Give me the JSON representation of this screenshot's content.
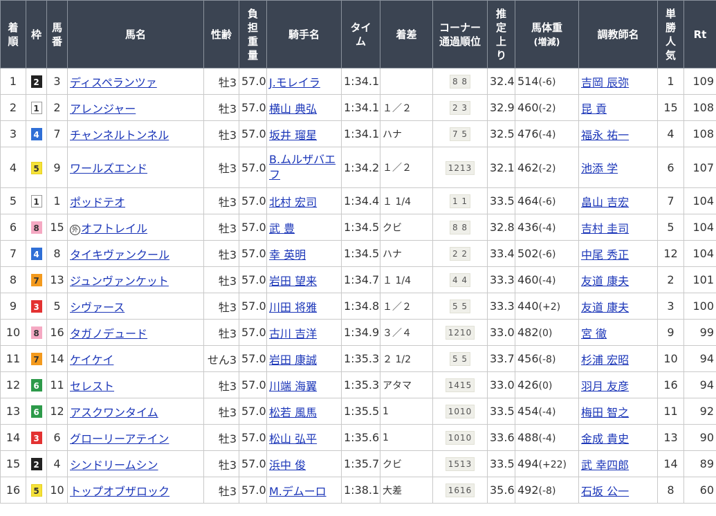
{
  "headers": {
    "rank": [
      "着",
      "順"
    ],
    "waku": "枠",
    "umaban": [
      "馬",
      "番"
    ],
    "name": "馬名",
    "sexage": "性齢",
    "weight": [
      "負",
      "担",
      "重",
      "量"
    ],
    "jockey": "騎手名",
    "time": [
      "タイ",
      "ム"
    ],
    "margin": "着差",
    "corner": [
      "コーナー",
      "通過順位"
    ],
    "last3f": [
      "推",
      "定",
      "上",
      "り"
    ],
    "body": [
      "馬体重",
      "(増減)"
    ],
    "trainer": "調教師名",
    "popularity": [
      "単",
      "勝",
      "人",
      "気"
    ],
    "rt": "Rt"
  },
  "waku_colors": {
    "1": {
      "bg": "#ffffff",
      "fg": "#333333",
      "border": "#999999"
    },
    "2": {
      "bg": "#222222",
      "fg": "#ffffff",
      "border": "#222222"
    },
    "3": {
      "bg": "#e33232",
      "fg": "#ffffff",
      "border": "#e33232"
    },
    "4": {
      "bg": "#2f6fd6",
      "fg": "#ffffff",
      "border": "#2f6fd6"
    },
    "5": {
      "bg": "#f5e23a",
      "fg": "#333333",
      "border": "#e6cf1e"
    },
    "6": {
      "bg": "#2d9a4a",
      "fg": "#ffffff",
      "border": "#2d9a4a"
    },
    "7": {
      "bg": "#f39a1e",
      "fg": "#333333",
      "border": "#f39a1e"
    },
    "8": {
      "bg": "#f5a9c3",
      "fg": "#333333",
      "border": "#f5a9c3"
    }
  },
  "rows": [
    {
      "rank": "1",
      "waku": "2",
      "umaban": "3",
      "mark": "",
      "name": "ディスペランツァ",
      "sexage": "牡3",
      "weight": "57.0",
      "jockey": "J.モレイラ",
      "jockey_link": true,
      "time": "1:34.1",
      "margin": "",
      "corner": "8 8",
      "last3f": "32.4",
      "body": "514",
      "diff": "(-6)",
      "trainer": "吉岡 辰弥",
      "popularity": "1",
      "rt": "109"
    },
    {
      "rank": "2",
      "waku": "1",
      "umaban": "2",
      "mark": "",
      "name": "アレンジャー",
      "sexage": "牡3",
      "weight": "57.0",
      "jockey": "横山 典弘",
      "jockey_link": true,
      "time": "1:34.1",
      "margin": "１／２",
      "corner": "2 3",
      "last3f": "32.9",
      "body": "460",
      "diff": "(-2)",
      "trainer": "昆 貢",
      "popularity": "15",
      "rt": "108"
    },
    {
      "rank": "3",
      "waku": "4",
      "umaban": "7",
      "mark": "",
      "name": "チャンネルトンネル",
      "sexage": "牡3",
      "weight": "57.0",
      "jockey": "坂井 瑠星",
      "jockey_link": true,
      "time": "1:34.1",
      "margin": "ハナ",
      "corner": "7 5",
      "last3f": "32.5",
      "body": "476",
      "diff": "(-4)",
      "trainer": "福永 祐一",
      "popularity": "4",
      "rt": "108"
    },
    {
      "rank": "4",
      "waku": "5",
      "umaban": "9",
      "mark": "",
      "name": "ワールズエンド",
      "sexage": "牡3",
      "weight": "57.0",
      "jockey": "B.ムルザバエフ",
      "jockey_link": false,
      "time": "1:34.2",
      "margin": "１／２",
      "corner": "1213",
      "last3f": "32.1",
      "body": "462",
      "diff": "(-2)",
      "trainer": "池添 学",
      "popularity": "6",
      "rt": "107"
    },
    {
      "rank": "5",
      "waku": "1",
      "umaban": "1",
      "mark": "",
      "name": "ポッドテオ",
      "sexage": "牡3",
      "weight": "57.0",
      "jockey": "北村 宏司",
      "jockey_link": true,
      "time": "1:34.4",
      "margin": "１ 1/4",
      "corner": "1 1",
      "last3f": "33.5",
      "body": "464",
      "diff": "(-6)",
      "trainer": "畠山 吉宏",
      "popularity": "7",
      "rt": "104"
    },
    {
      "rank": "6",
      "waku": "8",
      "umaban": "15",
      "mark": "外",
      "name": "オフトレイル",
      "sexage": "牡3",
      "weight": "57.0",
      "jockey": "武 豊",
      "jockey_link": true,
      "time": "1:34.5",
      "margin": "クビ",
      "corner": "8 8",
      "last3f": "32.8",
      "body": "436",
      "diff": "(-4)",
      "trainer": "吉村 圭司",
      "popularity": "5",
      "rt": "104"
    },
    {
      "rank": "7",
      "waku": "4",
      "umaban": "8",
      "mark": "",
      "name": "タイキヴァンクール",
      "sexage": "牡3",
      "weight": "57.0",
      "jockey": "幸 英明",
      "jockey_link": true,
      "time": "1:34.5",
      "margin": "ハナ",
      "corner": "2 2",
      "last3f": "33.4",
      "body": "502",
      "diff": "(-6)",
      "trainer": "中尾 秀正",
      "popularity": "12",
      "rt": "104"
    },
    {
      "rank": "8",
      "waku": "7",
      "umaban": "13",
      "mark": "",
      "name": "ジュンヴァンケット",
      "sexage": "牡3",
      "weight": "57.0",
      "jockey": "岩田 望来",
      "jockey_link": true,
      "time": "1:34.7",
      "margin": "１ 1/4",
      "corner": "4 4",
      "last3f": "33.3",
      "body": "460",
      "diff": "(-4)",
      "trainer": "友道 康夫",
      "popularity": "2",
      "rt": "101"
    },
    {
      "rank": "9",
      "waku": "3",
      "umaban": "5",
      "mark": "",
      "name": "シヴァース",
      "sexage": "牡3",
      "weight": "57.0",
      "jockey": "川田 将雅",
      "jockey_link": true,
      "time": "1:34.8",
      "margin": "１／２",
      "corner": "5 5",
      "last3f": "33.3",
      "body": "440",
      "diff": "(+2)",
      "trainer": "友道 康夫",
      "popularity": "3",
      "rt": "100"
    },
    {
      "rank": "10",
      "waku": "8",
      "umaban": "16",
      "mark": "",
      "name": "タガノデュード",
      "sexage": "牡3",
      "weight": "57.0",
      "jockey": "古川 吉洋",
      "jockey_link": true,
      "time": "1:34.9",
      "margin": "３／４",
      "corner": "1210",
      "last3f": "33.0",
      "body": "482",
      "diff": "(0)",
      "trainer": "宮 徹",
      "popularity": "9",
      "rt": "99"
    },
    {
      "rank": "11",
      "waku": "7",
      "umaban": "14",
      "mark": "",
      "name": "ケイケイ",
      "sexage": "せん3",
      "weight": "57.0",
      "jockey": "岩田 康誠",
      "jockey_link": true,
      "time": "1:35.3",
      "margin": "２ 1/2",
      "corner": "5 5",
      "last3f": "33.7",
      "body": "456",
      "diff": "(-8)",
      "trainer": "杉浦 宏昭",
      "popularity": "10",
      "rt": "94"
    },
    {
      "rank": "12",
      "waku": "6",
      "umaban": "11",
      "mark": "",
      "name": "セレスト",
      "sexage": "牡3",
      "weight": "57.0",
      "jockey": "川端 海翼",
      "jockey_link": true,
      "time": "1:35.3",
      "margin": "アタマ",
      "corner": "1415",
      "last3f": "33.0",
      "body": "426",
      "diff": "(0)",
      "trainer": "羽月 友彦",
      "popularity": "16",
      "rt": "94"
    },
    {
      "rank": "13",
      "waku": "6",
      "umaban": "12",
      "mark": "",
      "name": "アスクワンタイム",
      "sexage": "牡3",
      "weight": "57.0",
      "jockey": "松若 風馬",
      "jockey_link": true,
      "time": "1:35.5",
      "margin": "1",
      "corner": "1010",
      "last3f": "33.5",
      "body": "454",
      "diff": "(-4)",
      "trainer": "梅田 智之",
      "popularity": "11",
      "rt": "92"
    },
    {
      "rank": "14",
      "waku": "3",
      "umaban": "6",
      "mark": "",
      "name": "グローリーアテイン",
      "sexage": "牡3",
      "weight": "57.0",
      "jockey": "松山 弘平",
      "jockey_link": true,
      "time": "1:35.6",
      "margin": "1",
      "corner": "1010",
      "last3f": "33.6",
      "body": "488",
      "diff": "(-4)",
      "trainer": "金成 貴史",
      "popularity": "13",
      "rt": "90"
    },
    {
      "rank": "15",
      "waku": "2",
      "umaban": "4",
      "mark": "",
      "name": "シンドリームシン",
      "sexage": "牡3",
      "weight": "57.0",
      "jockey": "浜中 俊",
      "jockey_link": true,
      "time": "1:35.7",
      "margin": "クビ",
      "corner": "1513",
      "last3f": "33.5",
      "body": "494",
      "diff": "(+22)",
      "trainer": "武 幸四郎",
      "popularity": "14",
      "rt": "89"
    },
    {
      "rank": "16",
      "waku": "5",
      "umaban": "10",
      "mark": "",
      "name": "トップオブザロック",
      "sexage": "牡3",
      "weight": "57.0",
      "jockey": "M.デムーロ",
      "jockey_link": true,
      "time": "1:38.1",
      "margin": "大差",
      "corner": "1616",
      "last3f": "35.6",
      "body": "492",
      "diff": "(-8)",
      "trainer": "石坂 公一",
      "popularity": "8",
      "rt": "60"
    }
  ]
}
